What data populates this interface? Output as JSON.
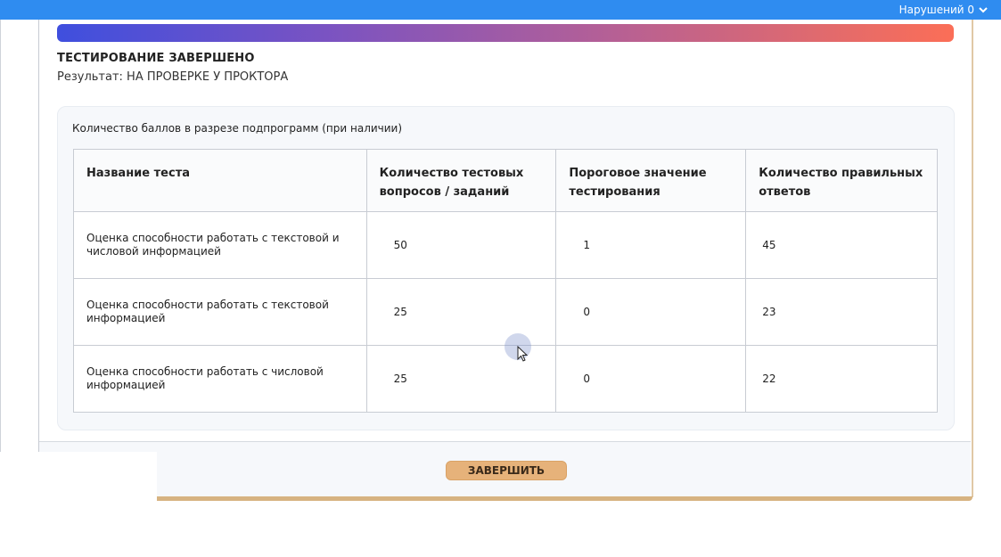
{
  "topbar": {
    "violations_label": "Нарушений 0",
    "chevron_icon": "chevron-down-icon"
  },
  "status": {
    "title": "ТЕСТИРОВАНИЕ ЗАВЕРШЕНО",
    "result": "Результат: НА ПРОВЕРКЕ У ПРОКТОРА"
  },
  "panel": {
    "caption": "Количество баллов в разрезе подпрограмм (при наличии)"
  },
  "table": {
    "headers": [
      "Название теста",
      "Количество тестовых вопросов / заданий",
      "Пороговое значение тестирования",
      "Количество правильных  ответов"
    ],
    "rows": [
      [
        " Оценка способности работать с текстовой и числовой информацией",
        "50",
        "1",
        "45"
      ],
      [
        " Оценка способности работать с текстовой информацией",
        "25",
        "0",
        "23"
      ],
      [
        " Оценка способности работать с числовой информацией",
        "25",
        "0",
        "22"
      ]
    ]
  },
  "footer": {
    "finish_label": "ЗАВЕРШИТЬ"
  },
  "colors": {
    "topbar": "#2f8cf0",
    "gradient_start": "#3f4fde",
    "gradient_end": "#fb6e57",
    "finish_button": "#e6b27a"
  }
}
